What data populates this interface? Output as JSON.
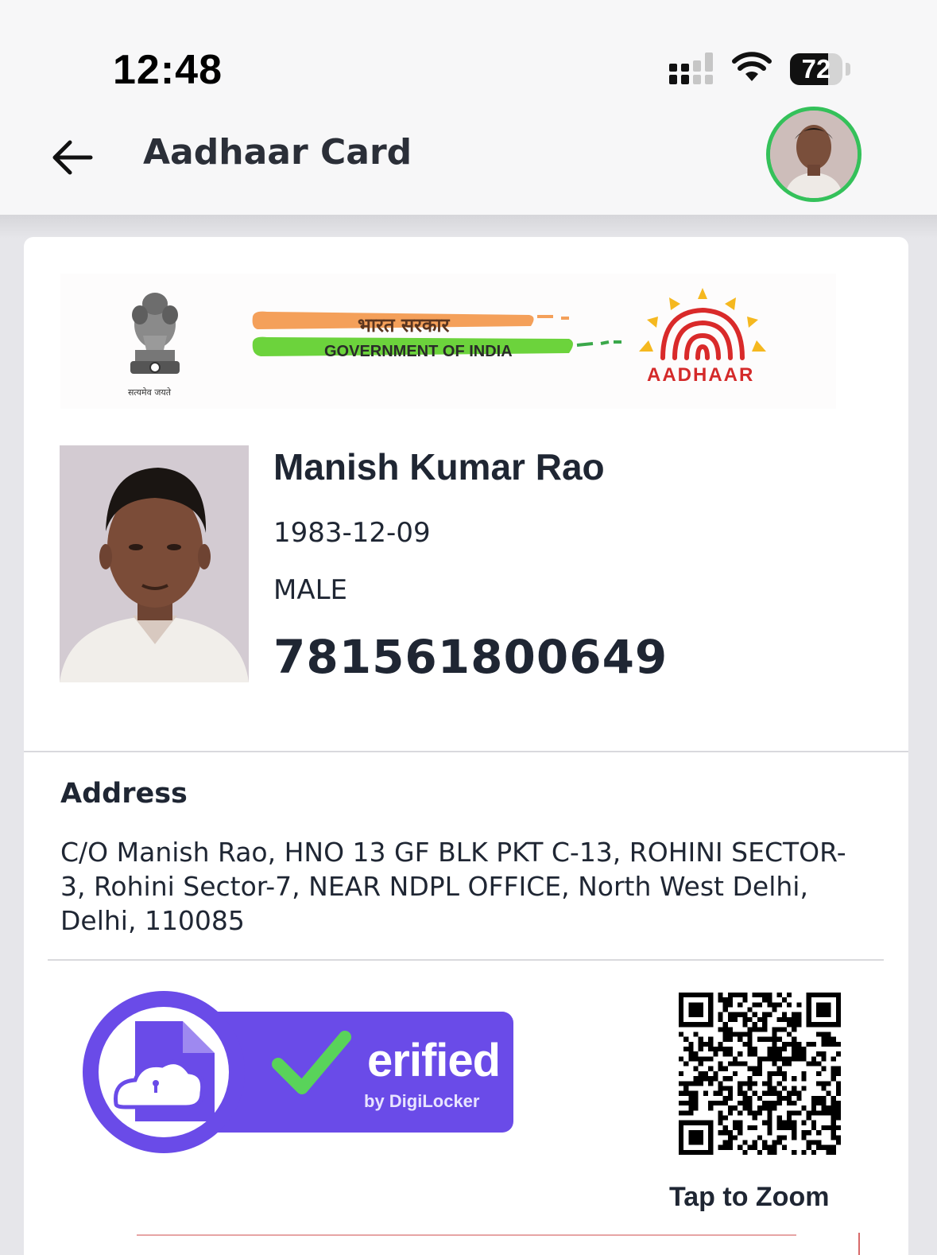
{
  "status_bar": {
    "time": "12:48",
    "battery": "72",
    "battery_level_percent": 72,
    "icons": [
      "cellular-signal-icon",
      "wifi-icon",
      "battery-icon"
    ]
  },
  "header": {
    "title": "Aadhaar Card",
    "back_icon": "arrow-left-icon",
    "accent_color": "#34c15a"
  },
  "card": {
    "banner": {
      "emblem_motto": "सत्यमेव जयते",
      "hindi": "भारत सरकार",
      "gov": "GOVERNMENT OF INDIA",
      "logo_text": "AADHAAR"
    },
    "holder": {
      "name": "Manish Kumar Rao",
      "dob": "1983-12-09",
      "gender": "MALE",
      "uid": "781561800649"
    },
    "address": {
      "label": "Address",
      "text": "C/O Manish Rao, HNO 13 GF BLK PKT C-13, ROHINI SECTOR-3, Rohini Sector-7, NEAR NDPL OFFICE, North West Delhi, Delhi, 110085"
    },
    "verified": {
      "word": "erified",
      "by": "by DigiLocker",
      "color": "#6a4be8"
    },
    "qr": {
      "zoom_label": "Tap to Zoom"
    }
  }
}
